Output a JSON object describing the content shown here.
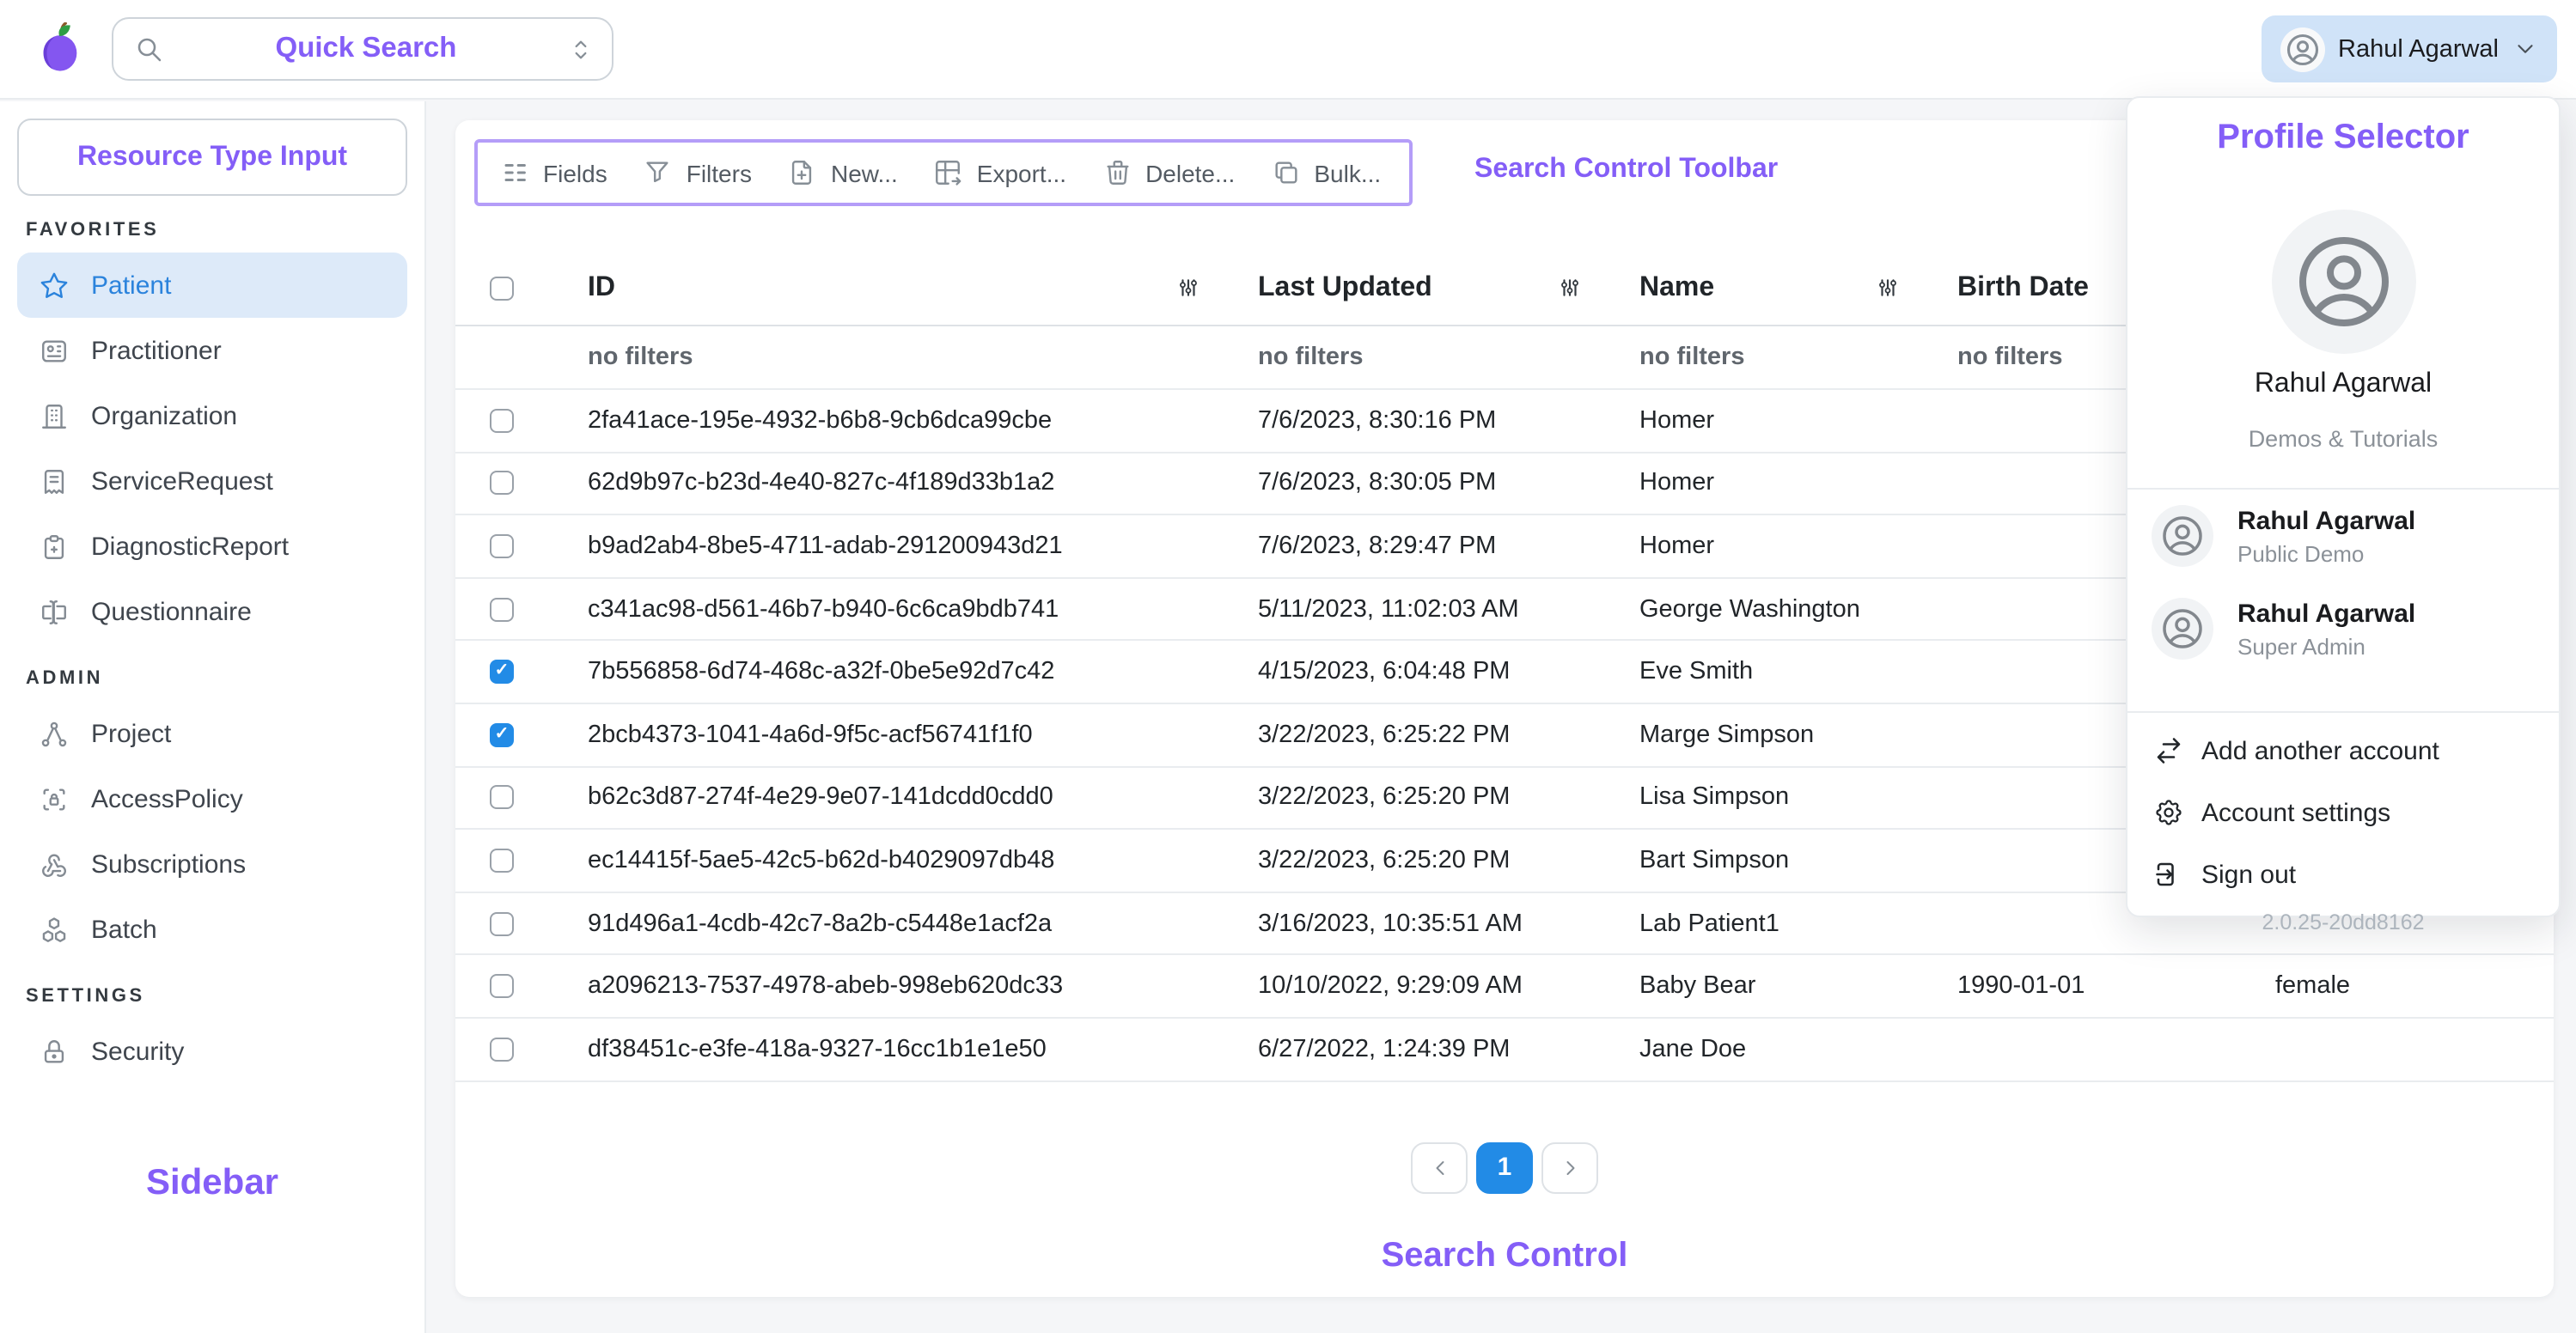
{
  "colors": {
    "annotation_purple": "#845ef7",
    "annotation_box_border": "#b49df8",
    "accent_blue": "#228be6",
    "selected_row_bg": "#ddeaf9",
    "profile_button_bg": "#d0e3f8"
  },
  "topbar": {
    "quick_search_label": "Quick Search",
    "profile_name": "Rahul Agarwal"
  },
  "sidebar": {
    "resource_type_input_label": "Resource Type Input",
    "annotation": "Sidebar",
    "sections": [
      {
        "label": "FAVORITES",
        "items": [
          {
            "label": "Patient",
            "icon": "star",
            "active": true
          },
          {
            "label": "Practitioner",
            "icon": "id-card"
          },
          {
            "label": "Organization",
            "icon": "building"
          },
          {
            "label": "ServiceRequest",
            "icon": "receipt"
          },
          {
            "label": "DiagnosticReport",
            "icon": "clipboard-plus"
          },
          {
            "label": "Questionnaire",
            "icon": "forms"
          }
        ]
      },
      {
        "label": "ADMIN",
        "items": [
          {
            "label": "Project",
            "icon": "hierarchy"
          },
          {
            "label": "AccessPolicy",
            "icon": "scan-lock"
          },
          {
            "label": "Subscriptions",
            "icon": "webhook"
          },
          {
            "label": "Batch",
            "icon": "cubes"
          }
        ]
      },
      {
        "label": "SETTINGS",
        "items": [
          {
            "label": "Security",
            "icon": "lock"
          }
        ]
      }
    ]
  },
  "toolbar": {
    "annotation": "Search Control Toolbar",
    "buttons": [
      {
        "label": "Fields",
        "icon": "columns"
      },
      {
        "label": "Filters",
        "icon": "filter"
      },
      {
        "label": "New...",
        "icon": "file-plus"
      },
      {
        "label": "Export...",
        "icon": "table-export"
      },
      {
        "label": "Delete...",
        "icon": "trash"
      },
      {
        "label": "Bulk...",
        "icon": "copy"
      }
    ]
  },
  "table": {
    "columns": [
      {
        "label": "ID"
      },
      {
        "label": "Last Updated"
      },
      {
        "label": "Name"
      },
      {
        "label": "Birth Date"
      },
      {
        "label": ""
      }
    ],
    "filter_row": [
      "no filters",
      "no filters",
      "no filters",
      "no filters"
    ],
    "rows": [
      {
        "id": "2fa41ace-195e-4932-b6b8-9cb6dca99cbe",
        "updated": "7/6/2023, 8:30:16 PM",
        "name": "Homer",
        "birth": "",
        "gender": "",
        "checked": false
      },
      {
        "id": "62d9b97c-b23d-4e40-827c-4f189d33b1a2",
        "updated": "7/6/2023, 8:30:05 PM",
        "name": "Homer",
        "birth": "",
        "gender": "",
        "checked": false
      },
      {
        "id": "b9ad2ab4-8be5-4711-adab-291200943d21",
        "updated": "7/6/2023, 8:29:47 PM",
        "name": "Homer",
        "birth": "",
        "gender": "",
        "checked": false
      },
      {
        "id": "c341ac98-d561-46b7-b940-6c6ca9bdb741",
        "updated": "5/11/2023, 11:02:03 AM",
        "name": "George Washington",
        "birth": "",
        "gender": "",
        "checked": false
      },
      {
        "id": "7b556858-6d74-468c-a32f-0be5e92d7c42",
        "updated": "4/15/2023, 6:04:48 PM",
        "name": "Eve Smith",
        "birth": "",
        "gender": "",
        "checked": true
      },
      {
        "id": "2bcb4373-1041-4a6d-9f5c-acf56741f1f0",
        "updated": "3/22/2023, 6:25:22 PM",
        "name": "Marge Simpson",
        "birth": "",
        "gender": "",
        "checked": true
      },
      {
        "id": "b62c3d87-274f-4e29-9e07-141dcdd0cdd0",
        "updated": "3/22/2023, 6:25:20 PM",
        "name": "Lisa Simpson",
        "birth": "",
        "gender": "",
        "checked": false
      },
      {
        "id": "ec14415f-5ae5-42c5-b62d-b4029097db48",
        "updated": "3/22/2023, 6:25:20 PM",
        "name": "Bart Simpson",
        "birth": "",
        "gender": "",
        "checked": false
      },
      {
        "id": "91d496a1-4cdb-42c7-8a2b-c5448e1acf2a",
        "updated": "3/16/2023, 10:35:51 AM",
        "name": "Lab Patient1",
        "birth": "",
        "gender": "",
        "checked": false
      },
      {
        "id": "a2096213-7537-4978-abeb-998eb620dc33",
        "updated": "10/10/2022, 9:29:09 AM",
        "name": "Baby Bear",
        "birth": "1990-01-01",
        "gender": "female",
        "checked": false
      },
      {
        "id": "df38451c-e3fe-418a-9327-16cc1b1e1e50",
        "updated": "6/27/2022, 1:24:39 PM",
        "name": "Jane Doe",
        "birth": "",
        "gender": "",
        "checked": false
      }
    ]
  },
  "pagination": {
    "current": "1"
  },
  "search_control_annotation": "Search Control",
  "profile_menu": {
    "annotation": "Profile Selector",
    "user": {
      "name": "Rahul Agarwal",
      "project": "Demos & Tutorials"
    },
    "accounts": [
      {
        "name": "Rahul Agarwal",
        "project": "Public Demo"
      },
      {
        "name": "Rahul Agarwal",
        "project": "Super Admin"
      }
    ],
    "menu": [
      {
        "label": "Add another account",
        "icon": "switch-arrows"
      },
      {
        "label": "Account settings",
        "icon": "gear"
      },
      {
        "label": "Sign out",
        "icon": "logout"
      }
    ],
    "version": "2.0.25-20dd8162"
  }
}
